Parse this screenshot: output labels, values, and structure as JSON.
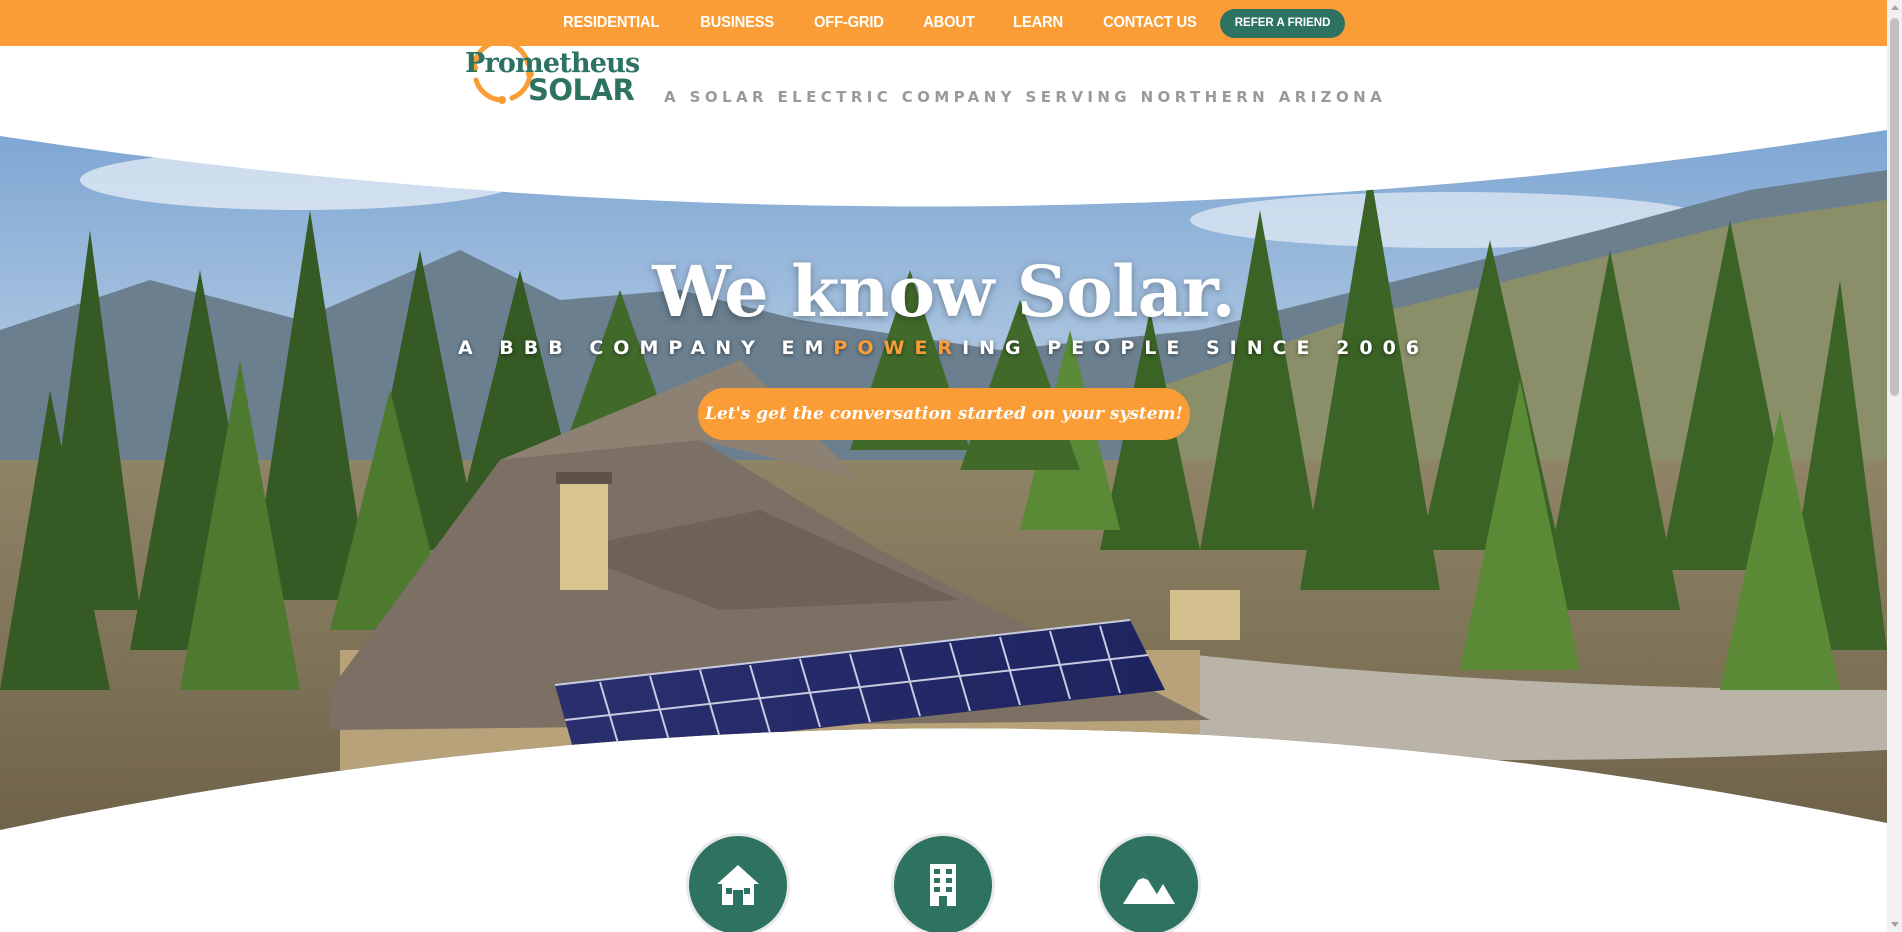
{
  "nav": {
    "items": [
      {
        "label": "RESIDENTIAL"
      },
      {
        "label": "BUSINESS"
      },
      {
        "label": "OFF-GRID"
      },
      {
        "label": "ABOUT"
      },
      {
        "label": "LEARN"
      },
      {
        "label": "CONTACT US"
      }
    ],
    "refer_label": "REFER A FRIEND"
  },
  "logo": {
    "line1": "Prometheus",
    "line2": "SOLAR"
  },
  "tagline": "A SOLAR ELECTRIC COMPANY SERVING NORTHERN ARIZONA",
  "hero": {
    "title": "We know Solar.",
    "subtitle_pre": "A BBB COMPANY EM",
    "subtitle_highlight": "POWER",
    "subtitle_post": "ING PEOPLE SINCE 2006",
    "cta_label": "Let's get the conversation started on your system!"
  },
  "categories": [
    {
      "icon": "house-icon"
    },
    {
      "icon": "building-icon"
    },
    {
      "icon": "mountain-icon"
    }
  ],
  "colors": {
    "accent": "#fb9d37",
    "brand_green": "#2e7362",
    "tagline_gray": "#9a9a9a"
  }
}
